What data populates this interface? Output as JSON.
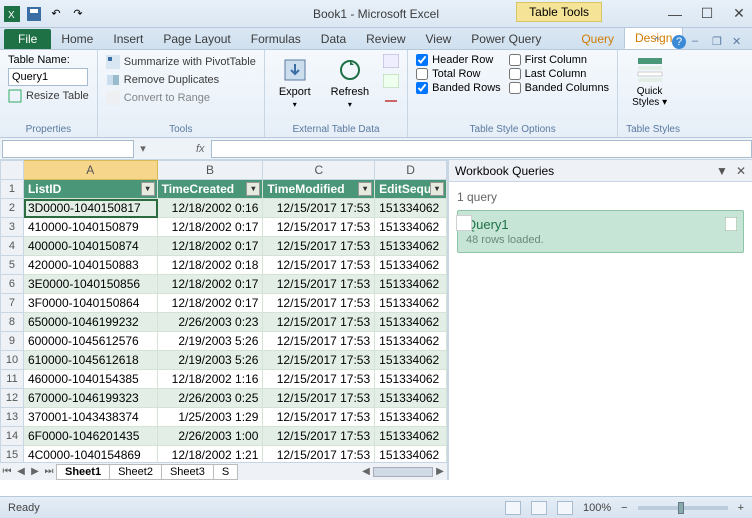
{
  "title": "Book1 - Microsoft Excel",
  "table_tools_label": "Table Tools",
  "tabs": {
    "file": "File",
    "list": [
      "Home",
      "Insert",
      "Page Layout",
      "Formulas",
      "Data",
      "Review",
      "View",
      "Power Query"
    ],
    "context": [
      "Query",
      "Design"
    ],
    "active": "Design"
  },
  "ribbon": {
    "properties": {
      "label": "Properties",
      "table_name_label": "Table Name:",
      "table_name_value": "Query1",
      "resize": "Resize Table"
    },
    "tools": {
      "label": "Tools",
      "pivot": "Summarize with PivotTable",
      "dedup": "Remove Duplicates",
      "range": "Convert to Range"
    },
    "ext": {
      "label": "External Table Data",
      "export": "Export",
      "refresh": "Refresh"
    },
    "tso": {
      "label": "Table Style Options",
      "header_row": "Header Row",
      "total_row": "Total Row",
      "banded_rows": "Banded Rows",
      "first_col": "First Column",
      "last_col": "Last Column",
      "banded_cols": "Banded Columns"
    },
    "styles": {
      "label": "Table Styles",
      "quick": "Quick\nStyles"
    }
  },
  "namebox": "",
  "fx": "fx",
  "grid": {
    "col_letters": [
      "A",
      "B",
      "C",
      "D"
    ],
    "headers": [
      "ListID",
      "TimeCreated",
      "TimeModified",
      "EditSeque"
    ],
    "rows": [
      {
        "n": 2,
        "a": "3D0000-1040150817",
        "b": "12/18/2002 0:16",
        "c": "12/15/2017 17:53",
        "d": "151334062"
      },
      {
        "n": 3,
        "a": "410000-1040150879",
        "b": "12/18/2002 0:17",
        "c": "12/15/2017 17:53",
        "d": "151334062"
      },
      {
        "n": 4,
        "a": "400000-1040150874",
        "b": "12/18/2002 0:17",
        "c": "12/15/2017 17:53",
        "d": "151334062"
      },
      {
        "n": 5,
        "a": "420000-1040150883",
        "b": "12/18/2002 0:18",
        "c": "12/15/2017 17:53",
        "d": "151334062"
      },
      {
        "n": 6,
        "a": "3E0000-1040150856",
        "b": "12/18/2002 0:17",
        "c": "12/15/2017 17:53",
        "d": "151334062"
      },
      {
        "n": 7,
        "a": "3F0000-1040150864",
        "b": "12/18/2002 0:17",
        "c": "12/15/2017 17:53",
        "d": "151334062"
      },
      {
        "n": 8,
        "a": "650000-1046199232",
        "b": "2/26/2003 0:23",
        "c": "12/15/2017 17:53",
        "d": "151334062"
      },
      {
        "n": 9,
        "a": "600000-1045612576",
        "b": "2/19/2003 5:26",
        "c": "12/15/2017 17:53",
        "d": "151334062"
      },
      {
        "n": 10,
        "a": "610000-1045612618",
        "b": "2/19/2003 5:26",
        "c": "12/15/2017 17:53",
        "d": "151334062"
      },
      {
        "n": 11,
        "a": "460000-1040154385",
        "b": "12/18/2002 1:16",
        "c": "12/15/2017 17:53",
        "d": "151334062"
      },
      {
        "n": 12,
        "a": "670000-1046199323",
        "b": "2/26/2003 0:25",
        "c": "12/15/2017 17:53",
        "d": "151334062"
      },
      {
        "n": 13,
        "a": "370001-1043438374",
        "b": "1/25/2003 1:29",
        "c": "12/15/2017 17:53",
        "d": "151334062"
      },
      {
        "n": 14,
        "a": "6F0000-1046201435",
        "b": "2/26/2003 1:00",
        "c": "12/15/2017 17:53",
        "d": "151334062"
      },
      {
        "n": 15,
        "a": "4C0000-1040154869",
        "b": "12/18/2002 1:21",
        "c": "12/15/2017 17:53",
        "d": "151334062"
      }
    ]
  },
  "sheets": [
    "Sheet1",
    "Sheet2",
    "Sheet3",
    "S"
  ],
  "pane": {
    "title": "Workbook Queries",
    "count": "1 query",
    "query_name": "Query1",
    "query_status": "48 rows loaded."
  },
  "status": {
    "ready": "Ready",
    "zoom": "100%"
  }
}
